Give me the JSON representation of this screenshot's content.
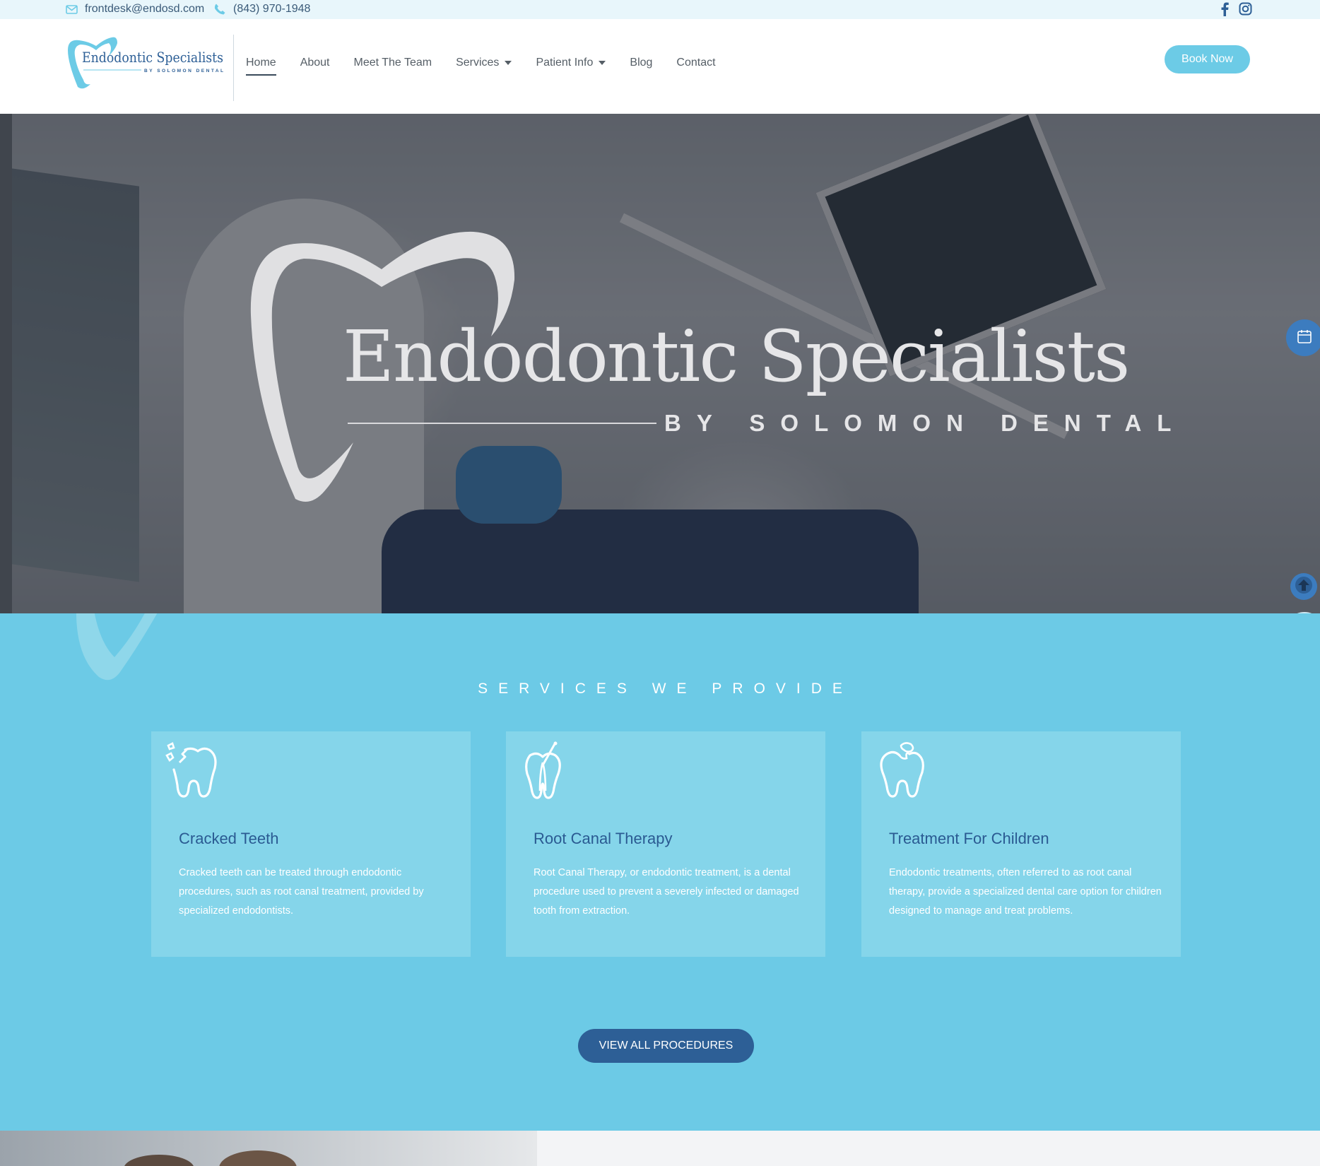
{
  "topbar": {
    "email": "frontdesk@endosd.com",
    "phone": "(843) 970-1948",
    "social": [
      "facebook-icon",
      "instagram-icon"
    ]
  },
  "header": {
    "logo_title": "Endodontic Specialists",
    "logo_subtitle": "BY SOLOMON DENTAL",
    "nav": [
      {
        "label": "Home",
        "active": true
      },
      {
        "label": "About"
      },
      {
        "label": "Meet The Team"
      },
      {
        "label": "Services",
        "dropdown": true
      },
      {
        "label": "Patient Info",
        "dropdown": true
      },
      {
        "label": "Blog"
      },
      {
        "label": "Contact"
      }
    ],
    "book_now": "Book Now"
  },
  "hero": {
    "title": "Endodontic Specialists",
    "subtitle": "BY SOLOMON DENTAL"
  },
  "services": {
    "heading": "SERVICES WE PROVIDE",
    "cards": [
      {
        "icon": "cracked-tooth-icon",
        "title": "Cracked Teeth",
        "text": "Cracked teeth can be treated through endodontic procedures, such as root canal treatment, provided by specialized endodontists."
      },
      {
        "icon": "root-canal-tooth-icon",
        "title": "Root Canal Therapy",
        "text": "Root Canal Therapy, or endodontic treatment, is a dental procedure used to prevent a severely infected or damaged tooth from extraction."
      },
      {
        "icon": "chipped-tooth-icon",
        "title": "Treatment For Children",
        "text": "Endodontic treatments, often referred to as root canal therapy, provide a specialized dental care option for children designed to manage and treat problems."
      }
    ],
    "view_all": "VIEW ALL PROCEDURES"
  },
  "floating": {
    "calendar": "calendar-icon",
    "scroll_top": "arrow-up-icon",
    "chat": "chat-icon"
  },
  "colors": {
    "accent": "#6ccae6",
    "navy": "#2d5f96",
    "topbar": "#e8f6fb"
  }
}
